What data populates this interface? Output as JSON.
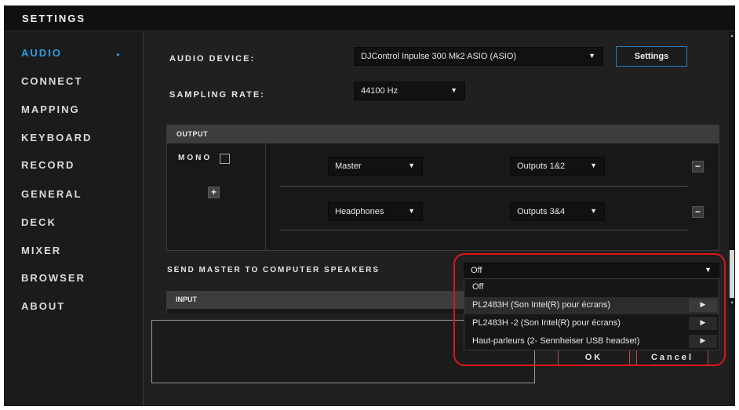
{
  "window": {
    "title": "SETTINGS"
  },
  "sidebar": {
    "items": [
      {
        "label": "AUDIO"
      },
      {
        "label": "CONNECT"
      },
      {
        "label": "MAPPING"
      },
      {
        "label": "KEYBOARD"
      },
      {
        "label": "RECORD"
      },
      {
        "label": "GENERAL"
      },
      {
        "label": "DECK"
      },
      {
        "label": "MIXER"
      },
      {
        "label": "BROWSER"
      },
      {
        "label": "ABOUT"
      }
    ],
    "active_arrow": "▸",
    "active_color": "#2b9fe6"
  },
  "audio": {
    "device_label": "AUDIO DEVICE:",
    "device_value": "DJControl Inpulse 300 Mk2 ASIO (ASIO)",
    "settings_button": "Settings",
    "sampling_label": "SAMPLING RATE:",
    "sampling_value": "44100 Hz",
    "caret": "▼"
  },
  "output": {
    "header": "OUTPUT",
    "mono_label": "MONO",
    "mono_checked": false,
    "add_button": "+",
    "remove_button": "−",
    "rows": [
      {
        "channel": "Master",
        "outputs": "Outputs 1&2"
      },
      {
        "channel": "Headphones",
        "outputs": "Outputs 3&4"
      }
    ]
  },
  "send_master": {
    "label": "SEND MASTER TO COMPUTER SPEAKERS",
    "value": "Off"
  },
  "input": {
    "header": "INPUT"
  },
  "dropdown_menu": {
    "items": [
      {
        "label": "Off",
        "submenu": false
      },
      {
        "label": "PL2483H (Son Intel(R) pour écrans)",
        "submenu": true,
        "highlighted": true
      },
      {
        "label": "PL2483H -2 (Son Intel(R) pour écrans)",
        "submenu": true
      },
      {
        "label": "Haut-parleurs (2- Sennheiser USB headset)",
        "submenu": true
      }
    ],
    "submenu_arrow": "▶"
  },
  "dialog": {
    "ok_label": "OK",
    "cancel_label": "Cancel"
  },
  "colors": {
    "accent": "#2b9fe6",
    "annotation": "#e0141a"
  }
}
